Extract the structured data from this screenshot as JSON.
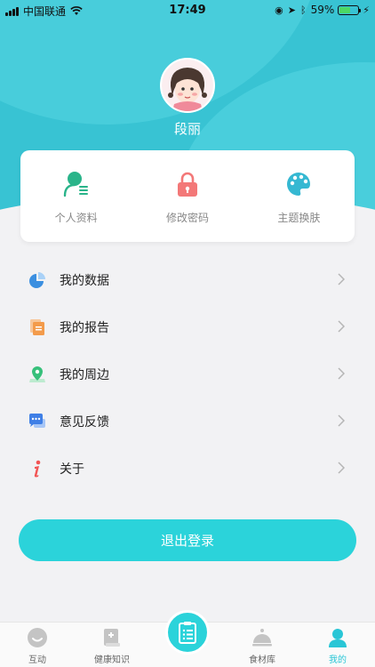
{
  "status_bar": {
    "carrier": "中国联通",
    "time": "17:49",
    "battery": "59%",
    "battery_level": 0.59
  },
  "profile": {
    "name": "段丽"
  },
  "quick_actions": [
    {
      "label": "个人资料",
      "icon": "profile-icon"
    },
    {
      "label": "修改密码",
      "icon": "lock-icon"
    },
    {
      "label": "主题换肤",
      "icon": "palette-icon"
    }
  ],
  "menu": {
    "items": [
      {
        "label": "我的数据",
        "icon": "pie-chart-icon"
      },
      {
        "label": "我的报告",
        "icon": "report-icon"
      },
      {
        "label": "我的周边",
        "icon": "location-icon"
      },
      {
        "label": "意见反馈",
        "icon": "feedback-icon"
      },
      {
        "label": "关于",
        "icon": "info-icon"
      }
    ]
  },
  "logout_label": "退出登录",
  "tabs": [
    {
      "label": "互动",
      "icon": "interact-icon"
    },
    {
      "label": "健康知识",
      "icon": "book-icon"
    },
    {
      "label": "",
      "icon": "clipboard-icon"
    },
    {
      "label": "食材库",
      "icon": "food-cover-icon"
    },
    {
      "label": "我的",
      "icon": "user-icon"
    }
  ],
  "colors": {
    "accent": "#2bd3da",
    "header": "#38c3d3",
    "active_tab": "#29c6d6"
  }
}
